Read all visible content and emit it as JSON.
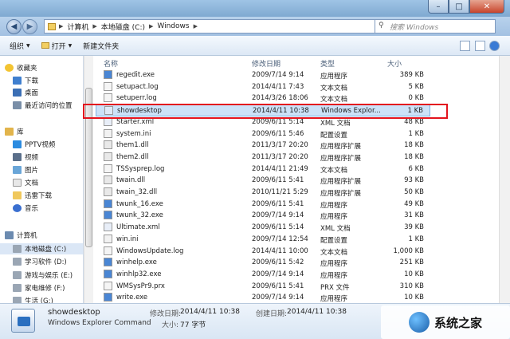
{
  "address": {
    "crumbs": [
      "计算机",
      "本地磁盘 (C:)",
      "Windows"
    ],
    "search_placeholder": "搜索 Windows"
  },
  "toolbar": {
    "organize": "组织",
    "open": "打开",
    "new_folder": "新建文件夹"
  },
  "nav": {
    "favorites": "收藏夹",
    "fav_items": [
      "下载",
      "桌面",
      "最近访问的位置"
    ],
    "libraries": "库",
    "lib_items": [
      "PPTV视频",
      "视频",
      "图片",
      "文档",
      "迅雷下载",
      "音乐"
    ],
    "computer": "计算机",
    "drives": [
      "本地磁盘 (C:)",
      "学习软件 (D:)",
      "游戏与娱乐 (E:)",
      "家电维修 (F:)",
      "生活 (G:)"
    ]
  },
  "columns": {
    "name": "名称",
    "date": "修改日期",
    "type": "类型",
    "size": "大小"
  },
  "files": [
    {
      "name": "regedit.exe",
      "date": "2009/7/14 9:14",
      "type": "应用程序",
      "size": "389 KB"
    },
    {
      "name": "setupact.log",
      "date": "2014/4/11 7:43",
      "type": "文本文档",
      "size": "5 KB"
    },
    {
      "name": "setuperr.log",
      "date": "2014/3/26 18:06",
      "type": "文本文档",
      "size": "0 KB"
    },
    {
      "name": "showdesktop",
      "date": "2014/4/11 10:38",
      "type": "Windows Explor...",
      "size": "1 KB"
    },
    {
      "name": "Starter.xml",
      "date": "2009/6/11 5:14",
      "type": "XML 文档",
      "size": "48 KB"
    },
    {
      "name": "system.ini",
      "date": "2009/6/11 5:46",
      "type": "配置设置",
      "size": "1 KB"
    },
    {
      "name": "them1.dll",
      "date": "2011/3/17 20:20",
      "type": "应用程序扩展",
      "size": "18 KB"
    },
    {
      "name": "them2.dll",
      "date": "2011/3/17 20:20",
      "type": "应用程序扩展",
      "size": "18 KB"
    },
    {
      "name": "TSSysprep.log",
      "date": "2014/4/11 21:49",
      "type": "文本文档",
      "size": "6 KB"
    },
    {
      "name": "twain.dll",
      "date": "2009/6/11 5:41",
      "type": "应用程序扩展",
      "size": "93 KB"
    },
    {
      "name": "twain_32.dll",
      "date": "2010/11/21 5:29",
      "type": "应用程序扩展",
      "size": "50 KB"
    },
    {
      "name": "twunk_16.exe",
      "date": "2009/6/11 5:41",
      "type": "应用程序",
      "size": "49 KB"
    },
    {
      "name": "twunk_32.exe",
      "date": "2009/7/14 9:14",
      "type": "应用程序",
      "size": "31 KB"
    },
    {
      "name": "Ultimate.xml",
      "date": "2009/6/11 5:14",
      "type": "XML 文档",
      "size": "39 KB"
    },
    {
      "name": "win.ini",
      "date": "2009/7/14 12:54",
      "type": "配置设置",
      "size": "1 KB"
    },
    {
      "name": "WindowsUpdate.log",
      "date": "2014/4/11 10:00",
      "type": "文本文档",
      "size": "1,000 KB"
    },
    {
      "name": "winhelp.exe",
      "date": "2009/6/11 5:42",
      "type": "应用程序",
      "size": "251 KB"
    },
    {
      "name": "winhlp32.exe",
      "date": "2009/7/14 9:14",
      "type": "应用程序",
      "size": "10 KB"
    },
    {
      "name": "WMSysPr9.prx",
      "date": "2009/6/11 5:41",
      "type": "PRX 文件",
      "size": "310 KB"
    },
    {
      "name": "write.exe",
      "date": "2009/7/14 9:14",
      "type": "应用程序",
      "size": "10 KB"
    }
  ],
  "selected_index": 3,
  "details": {
    "name": "showdesktop",
    "type": "Windows Explorer Command",
    "modified_label": "修改日期:",
    "modified": "2014/4/11 10:38",
    "created_label": "创建日期:",
    "created": "2014/4/11 10:38",
    "size_label": "大小:",
    "size": "77 字节"
  },
  "watermark": "系统之家"
}
